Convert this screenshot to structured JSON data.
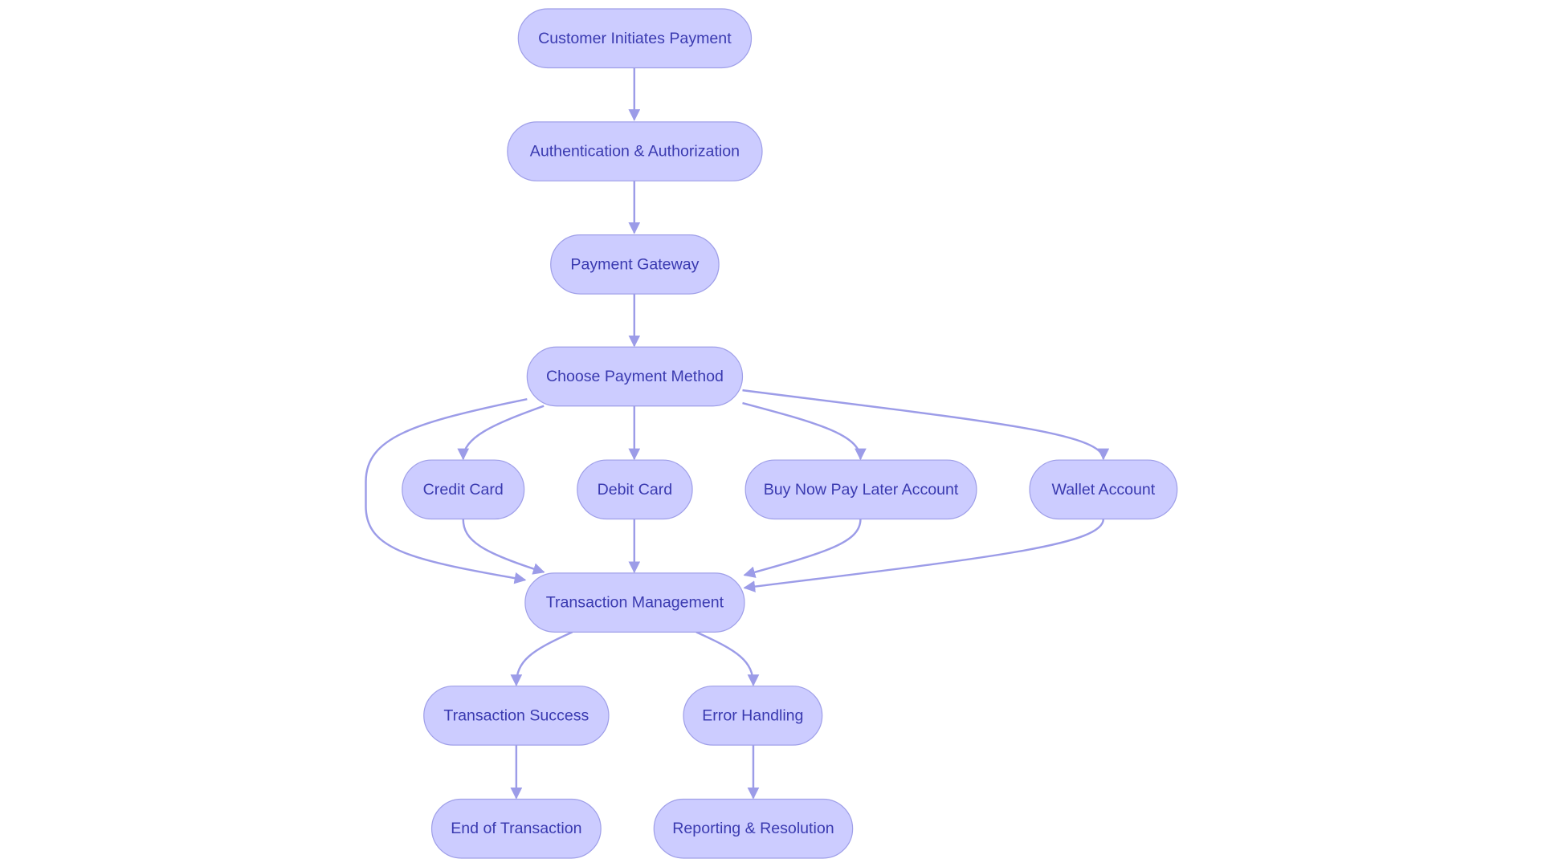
{
  "colors": {
    "node_fill": "#ccccff",
    "node_stroke": "#9f9fe8",
    "edge": "#9c9ce8",
    "text": "#3a3ab0",
    "background": "#ffffff"
  },
  "nodes": {
    "start": "Customer Initiates Payment",
    "auth": "Authentication & Authorization",
    "gateway": "Payment Gateway",
    "choose": "Choose Payment Method",
    "credit": "Credit Card",
    "debit": "Debit Card",
    "bnpl": "Buy Now Pay Later Account",
    "wallet": "Wallet Account",
    "txn": "Transaction Management",
    "success": "Transaction Success",
    "error": "Error Handling",
    "end": "End of Transaction",
    "report": "Reporting & Resolution"
  },
  "edges": [
    [
      "start",
      "auth"
    ],
    [
      "auth",
      "gateway"
    ],
    [
      "gateway",
      "choose"
    ],
    [
      "choose",
      "credit"
    ],
    [
      "choose",
      "debit"
    ],
    [
      "choose",
      "bnpl"
    ],
    [
      "choose",
      "wallet"
    ],
    [
      "choose",
      "txn"
    ],
    [
      "credit",
      "txn"
    ],
    [
      "debit",
      "txn"
    ],
    [
      "bnpl",
      "txn"
    ],
    [
      "wallet",
      "txn"
    ],
    [
      "txn",
      "success"
    ],
    [
      "txn",
      "error"
    ],
    [
      "success",
      "end"
    ],
    [
      "error",
      "report"
    ]
  ]
}
